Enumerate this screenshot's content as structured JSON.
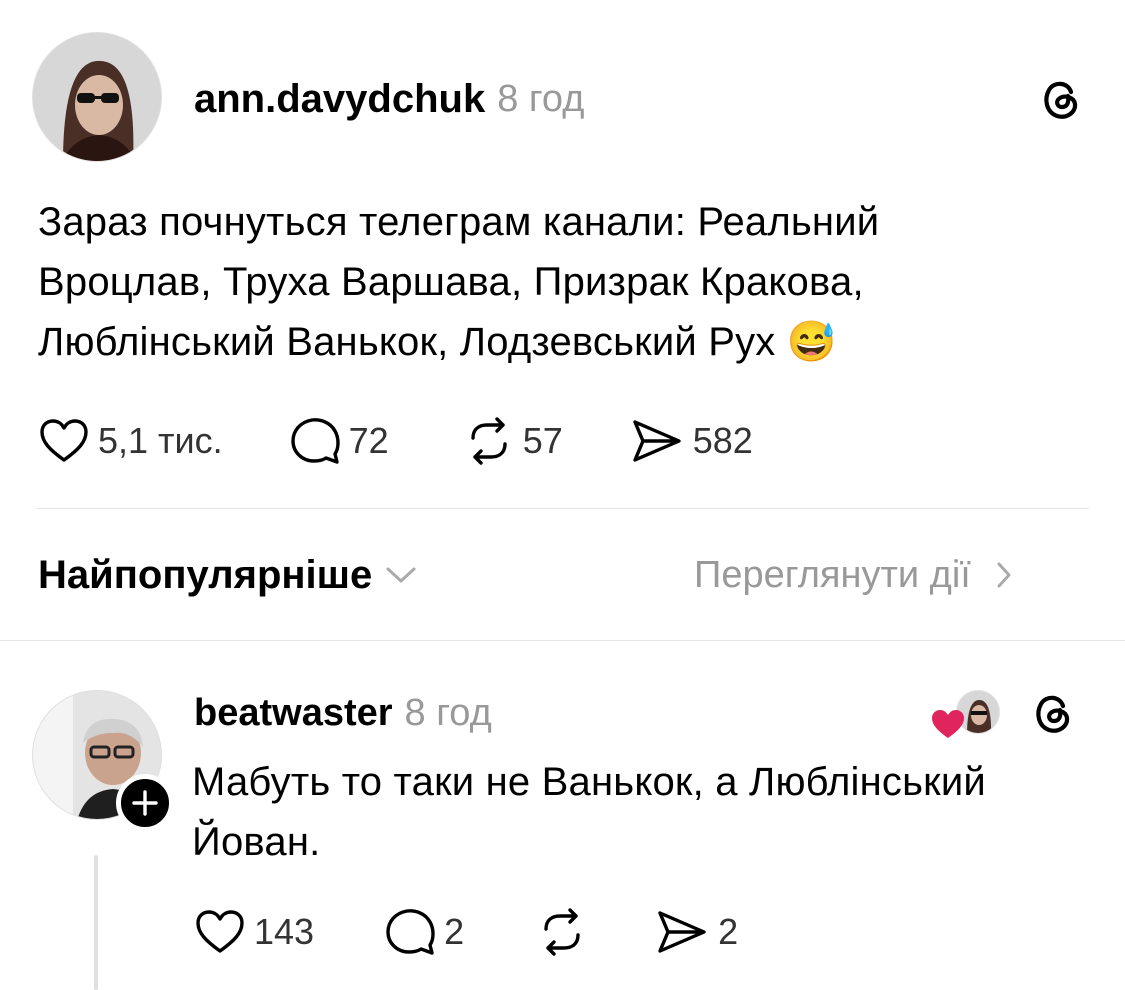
{
  "post": {
    "username": "ann.davydchuk",
    "time": "8 год",
    "text_lines": [
      "Зараз почнуться телеграм канали: Реальний",
      "Вроцлав, Труха Варшава, Призрак Кракова,",
      "Люблінський Ванькок, Лодзевський Рух"
    ],
    "emoji": "😅",
    "likes": "5,1 тис.",
    "replies": "72",
    "reposts": "57",
    "shares": "582"
  },
  "sort": {
    "label": "Найпопулярніше",
    "view_activity": "Переглянути дії"
  },
  "reply": {
    "username": "beatwaster",
    "time": "8 год",
    "text_lines": [
      "Мабуть то таки не Ванькок, а Люблінський",
      "Йован."
    ],
    "likes": "143",
    "replies": "2",
    "shares": "2"
  },
  "colors": {
    "heart": "#e0245e",
    "muted": "#999999"
  }
}
